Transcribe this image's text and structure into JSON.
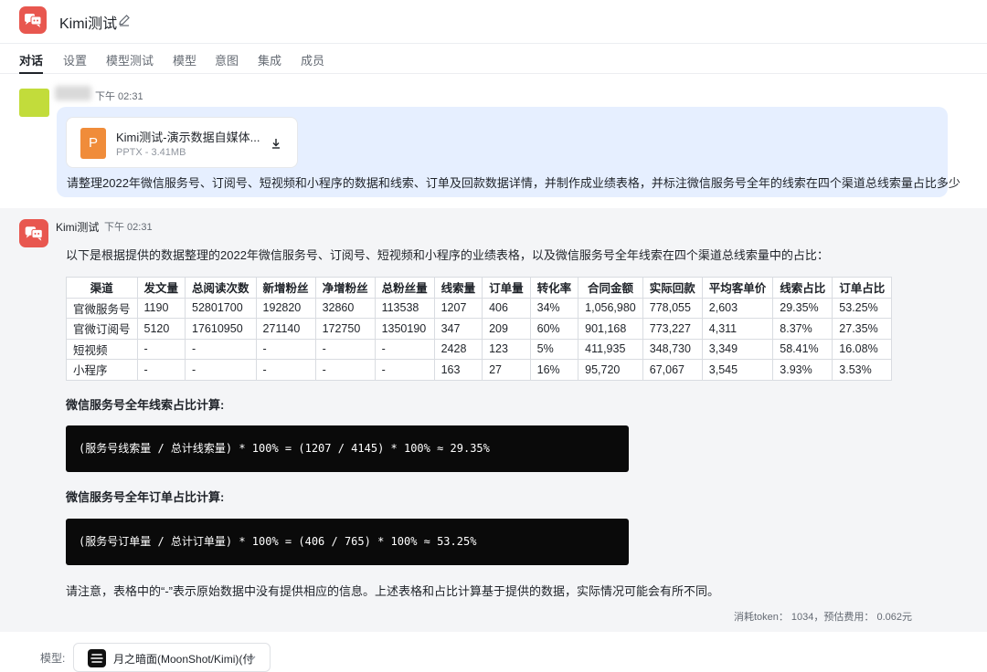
{
  "header": {
    "title": "Kimi测试"
  },
  "tabs": [
    "对话",
    "设置",
    "模型测试",
    "模型",
    "意图",
    "集成",
    "成员"
  ],
  "user_message": {
    "time": "下午 02:31",
    "file": {
      "name": "Kimi测试-演示数据自媒体...",
      "meta": "PPTX - 3.41MB",
      "type_letter": "P"
    },
    "text": "请整理2022年微信服务号、订阅号、短视频和小程序的数据和线索、订单及回款数据详情，并制作成业绩表格，并标注微信服务号全年的线索在四个渠道总线索量占比多少"
  },
  "bot_message": {
    "name": "Kimi测试",
    "time": "下午 02:31",
    "intro": "以下是根据提供的数据整理的2022年微信服务号、订阅号、短视频和小程序的业绩表格，以及微信服务号全年线索在四个渠道总线索量中的占比：",
    "table": {
      "headers": [
        "渠道",
        "发文量",
        "总阅读次数",
        "新增粉丝",
        "净增粉丝",
        "总粉丝量",
        "线索量",
        "订单量",
        "转化率",
        "合同金额",
        "实际回款",
        "平均客单价",
        "线索占比",
        "订单占比"
      ],
      "rows": [
        [
          "官微服务号",
          "1190",
          "52801700",
          "192820",
          "32860",
          "113538",
          "1207",
          "406",
          "34%",
          "1,056,980",
          "778,055",
          "2,603",
          "29.35%",
          "53.25%"
        ],
        [
          "官微订阅号",
          "5120",
          "17610950",
          "271140",
          "172750",
          "1350190",
          "347",
          "209",
          "60%",
          "901,168",
          "773,227",
          "4,311",
          "8.37%",
          "27.35%"
        ],
        [
          "短视频",
          "-",
          "-",
          "-",
          "-",
          "-",
          "2428",
          "123",
          "5%",
          "411,935",
          "348,730",
          "3,349",
          "58.41%",
          "16.08%"
        ],
        [
          "小程序",
          "-",
          "-",
          "-",
          "-",
          "-",
          "163",
          "27",
          "16%",
          "95,720",
          "67,067",
          "3,545",
          "3.93%",
          "3.53%"
        ]
      ]
    },
    "calc1_title": "微信服务号全年线索占比计算:",
    "calc1_code": "(服务号线索量 / 总计线索量) * 100% = (1207 / 4145) * 100% ≈ 29.35%",
    "calc2_title": "微信服务号全年订单占比计算:",
    "calc2_code": "(服务号订单量 / 总计订单量) * 100% = (406 / 765) * 100% ≈ 53.25%",
    "note": "请注意，表格中的“-”表示原始数据中没有提供相应的信息。上述表格和占比计算基于提供的数据，实际情况可能会有所不同。",
    "cost": "消耗token： 1034，预估费用： 0.062元"
  },
  "footer": {
    "model_label": "模型:",
    "model_name": "月之暗面(MoonShot/Kimi)(付"
  },
  "colors": {
    "brand": "#e8574f",
    "user_bubble": "#e6efff",
    "code_bg": "#0a0a0a",
    "file_icon": "#f08c3a"
  }
}
